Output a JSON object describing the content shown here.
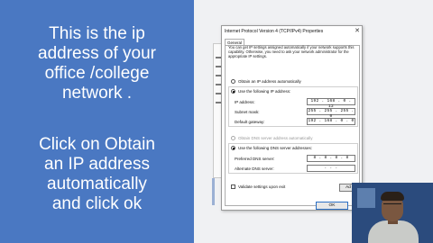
{
  "slide": {
    "text1": [
      "This is the ip",
      "address of your",
      "office /college",
      "network ."
    ],
    "text2": [
      "Click on Obtain",
      "an IP address",
      "automatically",
      "and click ok"
    ]
  },
  "dialog": {
    "title": "Internet Protocol Version 4 (TCP/IPv4) Properties",
    "close": "✕",
    "tab": "General",
    "info": "You can get IP settings assigned automatically if your network supports this capability. Otherwise, you need to ask your network administrator for the appropriate IP settings.",
    "obtain_ip_auto": "Obtain an IP address automatically",
    "use_following_ip": "Use the following IP address:",
    "ip_label": "IP address:",
    "ip_value": "192 . 168 .  0  . 12",
    "subnet_label": "Subnet mask:",
    "subnet_value": "255 . 255 . 255 .  0",
    "gateway_label": "Default gateway:",
    "gateway_value": "192 . 168 .  0  . 0",
    "obtain_dns_auto": "Obtain DNS server address automatically",
    "use_following_dns": "Use the following DNS server addresses:",
    "preferred_dns_label": "Preferred DNS server:",
    "preferred_dns_value": " 8  .  8  .  8  .  8",
    "alternate_dns_label": "Alternate DNS server:",
    "alternate_dns_value": " .      .      .",
    "validate": "Validate settings upon exit",
    "advanced": "Ad",
    "ok": "OK"
  }
}
